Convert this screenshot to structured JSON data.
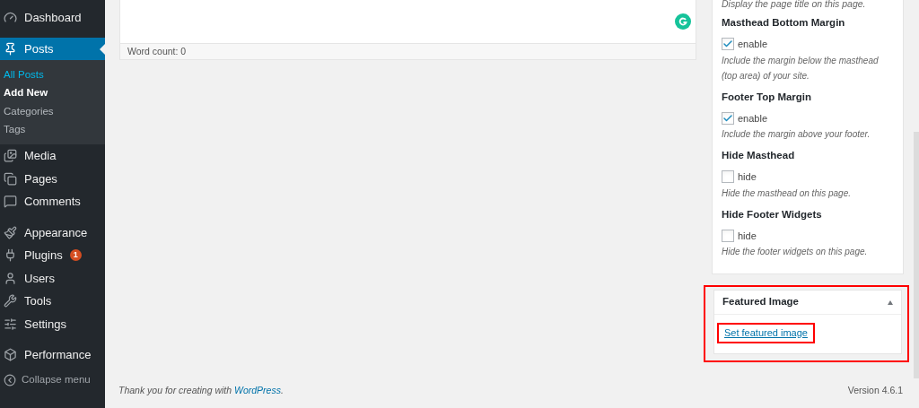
{
  "sidebar": {
    "groups": [
      [
        {
          "kind": "dashboard",
          "label": "Dashboard",
          "selected": false
        }
      ],
      [
        {
          "kind": "pin",
          "label": "Posts",
          "selected": true,
          "children": [
            {
              "label": "All Posts",
              "selected": true,
              "bold": false
            },
            {
              "label": "Add New",
              "selected": false,
              "bold": true
            },
            {
              "label": "Categories",
              "selected": false,
              "bold": false
            },
            {
              "label": "Tags",
              "selected": false,
              "bold": false
            }
          ]
        },
        {
          "kind": "media",
          "label": "Media",
          "selected": false
        },
        {
          "kind": "pages",
          "label": "Pages",
          "selected": false
        },
        {
          "kind": "comments",
          "label": "Comments",
          "selected": false
        }
      ],
      [
        {
          "kind": "appearance",
          "label": "Appearance",
          "selected": false
        },
        {
          "kind": "plugins",
          "label": "Plugins",
          "selected": false,
          "badge": "1"
        },
        {
          "kind": "users",
          "label": "Users",
          "selected": false
        },
        {
          "kind": "tools",
          "label": "Tools",
          "selected": false
        },
        {
          "kind": "settings",
          "label": "Settings",
          "selected": false
        }
      ],
      [
        {
          "kind": "performance",
          "label": "Performance",
          "selected": false
        }
      ]
    ],
    "collapse": "Collapse menu"
  },
  "editor": {
    "word_count": "Word count: 0"
  },
  "options_box": {
    "top_description": "Display the page title on this page.",
    "fields": [
      {
        "title": "Masthead Bottom Margin",
        "checkbox_label": "enable",
        "checked": true,
        "description": "Include the margin below the masthead (top area) of your site."
      },
      {
        "title": "Footer Top Margin",
        "checkbox_label": "enable",
        "checked": true,
        "description": "Include the margin above your footer."
      },
      {
        "title": "Hide Masthead",
        "checkbox_label": "hide",
        "checked": false,
        "description": "Hide the masthead on this page."
      },
      {
        "title": "Hide Footer Widgets",
        "checkbox_label": "hide",
        "checked": false,
        "description": "Hide the footer widgets on this page."
      }
    ]
  },
  "featured_image": {
    "title": "Featured Image",
    "expanded": true,
    "highlighted": true,
    "link": "Set featured image",
    "link_highlighted": true
  },
  "footer": {
    "thanks": "Thank you for creating with ",
    "link": "WordPress",
    "end": ".",
    "version": "Version 4.6.1"
  }
}
